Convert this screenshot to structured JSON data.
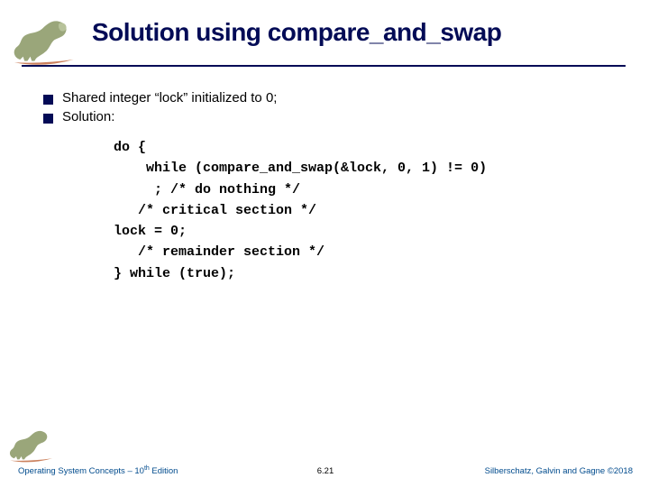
{
  "title": "Solution using compare_and_swap",
  "bullets": [
    "Shared integer  “lock”  initialized to 0;",
    "Solution:"
  ],
  "code": {
    "l1": "do {",
    "l2": "    while (compare_and_swap(&lock, 0, 1) != 0)",
    "l3": "     ; /* do nothing */",
    "l4": "   /* critical section */",
    "l5": "lock = 0;",
    "l6": "   /* remainder section */",
    "l7": "} while (true);"
  },
  "footer": {
    "left_a": "Operating System Concepts – 10",
    "left_sup": "th",
    "left_b": " Edition",
    "center": "6.21",
    "right": "Silberschatz, Galvin and Gagne ©2018"
  },
  "icons": {
    "dinosaur": "dinosaur"
  }
}
